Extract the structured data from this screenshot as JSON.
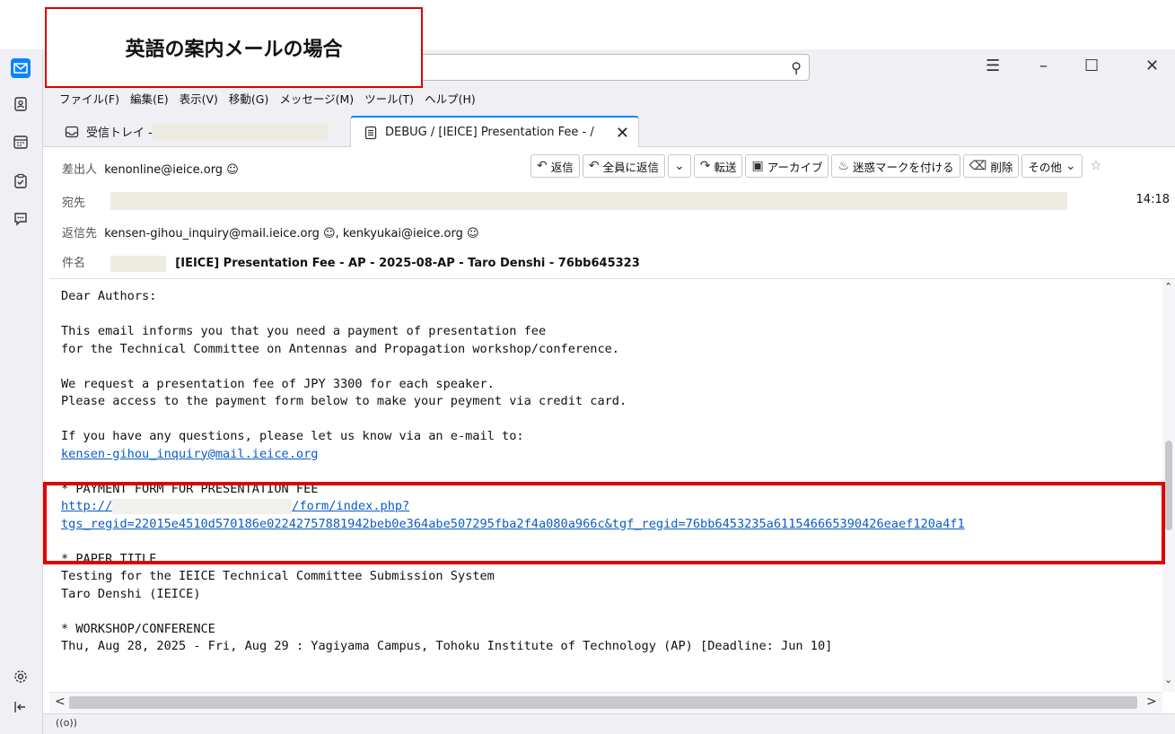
{
  "annotation": {
    "callout_text": "英語の案内メールの場合"
  },
  "menubar": {
    "items": [
      "ファイル(F)",
      "編集(E)",
      "表示(V)",
      "移動(G)",
      "メッセージ(M)",
      "ツール(T)",
      "ヘルプ(H)"
    ]
  },
  "tabs": [
    {
      "label": "受信トレイ - "
    },
    {
      "label": "DEBUG / [IEICE] Presentation Fee - /"
    }
  ],
  "header": {
    "from_label": "差出人",
    "from_value": "kenonline@ieice.org",
    "to_label": "宛先",
    "time": "14:18",
    "reply_to_label": "返信先",
    "reply_to_value": "kensen-gihou_inquiry@mail.ieice.org",
    "reply_to_value2": "kenkyukai@ieice.org",
    "subject_label": "件名",
    "subject_value": "[IEICE] Presentation Fee - AP - 2025-08-AP - Taro Denshi - 76bb645323",
    "buttons": {
      "reply": "返信",
      "reply_all": "全員に返信",
      "forward": "転送",
      "archive": "アーカイブ",
      "junk": "迷惑マークを付ける",
      "delete": "削除",
      "other": "その他"
    }
  },
  "body": {
    "l1": "Dear Authors:",
    "l2": "This email informs you that you need a payment of presentation fee",
    "l3": "for the Technical Committee on Antennas and Propagation workshop/conference.",
    "l4": "We request a presentation fee of JPY 3300 for each speaker.",
    "l5": "Please access to the payment form below to make your peyment via credit card.",
    "l6": "If you have any questions, please let us know via an e-mail to:",
    "l7": "kensen-gihou_inquiry@mail.ieice.org",
    "l8": "* PAYMENT FORM FOR PRESENTATION FEE",
    "l9a": "http://",
    "l9b": "/form/index.php?",
    "l10": "tgs_regid=22015e4510d570186e02242757881942beb0e364abe507295fba2f4a080a966c&tgf_regid=76bb6453235a611546665390426eaef120a4f1",
    "l11": "* PAPER TITLE",
    "l12": "Testing for the IEICE Technical Committee Submission System",
    "l13": "Taro Denshi (IEICE)",
    "l14": "* WORKSHOP/CONFERENCE",
    "l15": "Thu, Aug 28, 2025 - Fri, Aug 29 : Yagiyama Campus, Tohoku Institute of Technology (AP) [Deadline: Jun 10]"
  },
  "icons": {
    "spaces": [
      "mail-icon",
      "address-book-icon",
      "calendar-icon",
      "tasks-icon",
      "chat-icon",
      "settings-icon",
      "collapse-icon"
    ]
  },
  "colors": {
    "accent": "#0a84ff",
    "annotation": "#e00000",
    "link": "#0a5cc7"
  }
}
